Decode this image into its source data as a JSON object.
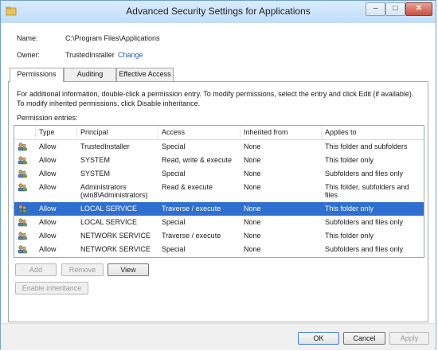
{
  "window": {
    "title": "Advanced Security Settings for Applications",
    "minimize_label": "–",
    "maximize_label": "□",
    "close_label": "✕"
  },
  "info": {
    "name_label": "Name:",
    "name_value": "C:\\Program Files\\Applications",
    "owner_label": "Owner:",
    "owner_value": "TrustedInstaller",
    "change_link": "Change"
  },
  "tabs": [
    "Permissions",
    "Auditing",
    "Effective Access"
  ],
  "description": "For additional information, double-click a permission entry. To modify permissions, select the entry and click Edit (if available). To modify inherited permissions, click Disable inheritance.",
  "entries_label": "Permission entries:",
  "columns": {
    "type": "Type",
    "principal": "Principal",
    "access": "Access",
    "inherited": "Inherited from",
    "applies": "Applies to"
  },
  "rows": [
    {
      "type": "Allow",
      "principal": "TrustedInstaller",
      "principal2": "",
      "access": "Special",
      "inherited": "None",
      "applies": "This folder and subfolders"
    },
    {
      "type": "Allow",
      "principal": "SYSTEM",
      "principal2": "",
      "access": "Read, write & execute",
      "inherited": "None",
      "applies": "This folder only"
    },
    {
      "type": "Allow",
      "principal": "SYSTEM",
      "principal2": "",
      "access": "Special",
      "inherited": "None",
      "applies": "Subfolders and files only"
    },
    {
      "type": "Allow",
      "principal": "Administrators",
      "principal2": "(win8\\Administrators)",
      "access": "Read & execute",
      "inherited": "None",
      "applies": "This folder, subfolders and files"
    },
    {
      "type": "Allow",
      "principal": "LOCAL SERVICE",
      "principal2": "",
      "access": "Traverse / execute",
      "inherited": "None",
      "applies": "This folder only"
    },
    {
      "type": "Allow",
      "principal": "LOCAL SERVICE",
      "principal2": "",
      "access": "Special",
      "inherited": "None",
      "applies": "Subfolders and files only"
    },
    {
      "type": "Allow",
      "principal": "NETWORK SERVICE",
      "principal2": "",
      "access": "Traverse / execute",
      "inherited": "None",
      "applies": "This folder only"
    },
    {
      "type": "Allow",
      "principal": "NETWORK SERVICE",
      "principal2": "",
      "access": "Special",
      "inherited": "None",
      "applies": "Subfolders and files only"
    }
  ],
  "selected_row": 4,
  "buttons": {
    "add": "Add",
    "remove": "Remove",
    "view": "View",
    "enable_inheritance": "Enable inheritance",
    "ok": "OK",
    "cancel": "Cancel",
    "apply": "Apply"
  },
  "colors": {
    "selection": "#2e6fd0",
    "link": "#1c5fb8",
    "titlebar": "#c2ddf8"
  }
}
